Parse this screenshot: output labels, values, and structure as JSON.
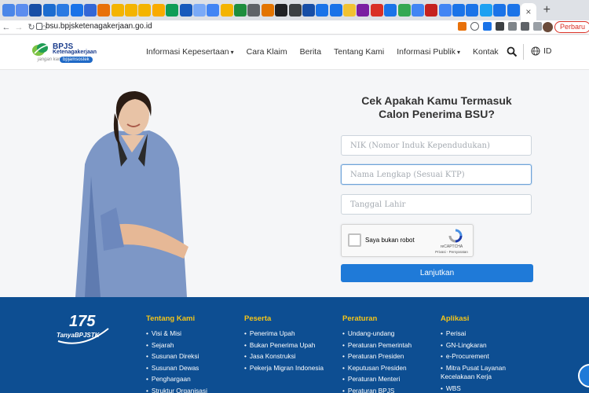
{
  "browser": {
    "tab_colors": [
      "#4a86e8",
      "#5b8def",
      "#174ea6",
      "#1c6dd0",
      "#2a7ae2",
      "#1a73e8",
      "#3367d6",
      "#e8710a",
      "#f4b400",
      "#f4b400",
      "#f4b400",
      "#f9ab00",
      "#0f9d58",
      "#185abc",
      "#7baaf7",
      "#4285f4",
      "#f4b400",
      "#1e8e3e",
      "#5f6368",
      "#e37400",
      "#202124",
      "#3c4043",
      "#174ea6",
      "#1a73e8",
      "#1a73e8",
      "#f1c232",
      "#7b1fa2",
      "#d93025",
      "#1a73e8",
      "#34a853",
      "#4285f4",
      "#c5221f",
      "#4285f4",
      "#1a73e8",
      "#1a73e8",
      "#1da1f2",
      "#1a73e8",
      "#1a73e8"
    ],
    "active_tab_close": "×",
    "new_tab": "+",
    "url": "bsu.bpjsketenagakerjaan.go.id",
    "update_button": "Perbaru"
  },
  "header": {
    "logo_title": "BPJS",
    "logo_subtitle": "Ketenagakerjaan",
    "logo_tag": "jangan kami",
    "logo_pill": "bpjamsostek",
    "nav": [
      {
        "label": "Informasi Kepesertaan",
        "has_caret": true
      },
      {
        "label": "Cara Klaim"
      },
      {
        "label": "Berita"
      },
      {
        "label": "Tentang Kami"
      },
      {
        "label": "Informasi Publik",
        "has_caret": true
      },
      {
        "label": "Kontak"
      }
    ],
    "caret": "▾",
    "lang": "ID"
  },
  "form": {
    "title_line1": "Cek Apakah Kamu Termasuk",
    "title_line2": "Calon Penerima BSU?",
    "nik_placeholder": "NIK (Nomor Induk Kependudukan)",
    "name_placeholder": "Nama Lengkap (Sesuai KTP)",
    "dob_placeholder": "Tanggal Lahir",
    "captcha_label": "Saya bukan robot",
    "captcha_brand": "reCAPTCHA",
    "captcha_links": "Privasi - Persyaratan",
    "submit": "Lanjutkan"
  },
  "footer": {
    "logo_number": "175",
    "logo_text": "TanyaBPJSTK",
    "columns": [
      {
        "title": "Tentang Kami",
        "items": [
          "Visi & Misi",
          "Sejarah",
          "Susunan Direksi",
          "Susunan Dewas",
          "Penghargaan",
          "Struktur Organisasi"
        ]
      },
      {
        "title": "Peserta",
        "items": [
          "Penerima Upah",
          "Bukan Penerima Upah",
          "Jasa Konstruksi",
          "Pekerja Migran Indonesia"
        ]
      },
      {
        "title": "Peraturan",
        "items": [
          "Undang-undang",
          "Peraturan Pemerintah",
          "Peraturan Presiden",
          "Keputusan Presiden",
          "Peraturan Menteri",
          "Peraturan BPJS"
        ]
      },
      {
        "title": "Aplikasi",
        "items": [
          "Perisai",
          "GN-Lingkaran",
          "e-Procurement",
          "Mitra Pusat Layanan Kecelakaan Kerja",
          "WBS"
        ]
      }
    ]
  },
  "colors": {
    "footer_bg": "#0d4e92",
    "footer_heading": "#f5c518",
    "button": "#1f7ad8",
    "brand_navy": "#1a3c8c"
  }
}
